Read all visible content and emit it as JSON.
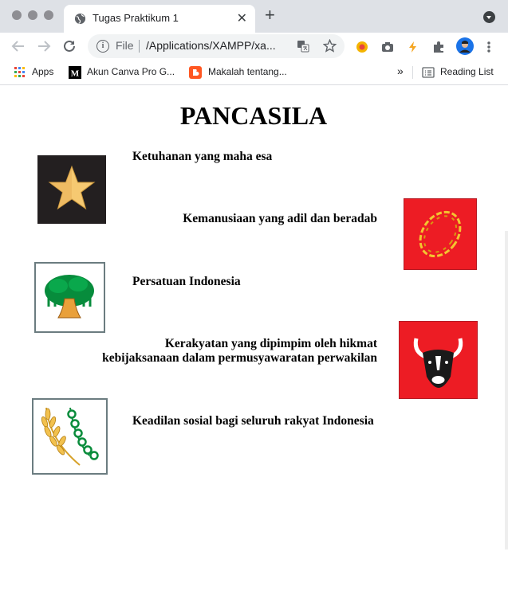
{
  "browser": {
    "tab_title": "Tugas Praktikum 1",
    "tab_close": "✕",
    "new_tab": "+",
    "url_scheme": "File",
    "url_text": "/Applications/XAMPP/xa...",
    "bookmarks": [
      {
        "label": "Apps",
        "icon": "apps-grid-icon"
      },
      {
        "label": "Akun Canva Pro G...",
        "icon": "medium-logo-icon"
      },
      {
        "label": "Makalah tentang...",
        "icon": "blogger-icon"
      }
    ],
    "overflow": "»",
    "reading_list": "Reading List"
  },
  "page": {
    "title": "PANCASILA",
    "sila": [
      {
        "text": "Ketuhanan yang maha esa",
        "emblem": "star-emblem",
        "color": "#231f20"
      },
      {
        "text": "Kemanusiaan yang adil dan beradab",
        "emblem": "chain-emblem",
        "color": "#ed1c24"
      },
      {
        "text": "Persatuan Indonesia",
        "emblem": "banyan-tree-emblem",
        "color": "#ffffff"
      },
      {
        "line1": "Kerakyatan yang dipimpim oleh hikmat",
        "line2": "kebijaksanaan dalam permusyawaratan perwakilan",
        "emblem": "bull-head-emblem",
        "color": "#ed1c24"
      },
      {
        "text": "Keadilan sosial bagi seluruh rakyat Indonesia",
        "emblem": "rice-cotton-emblem",
        "color": "#ffffff"
      }
    ]
  }
}
